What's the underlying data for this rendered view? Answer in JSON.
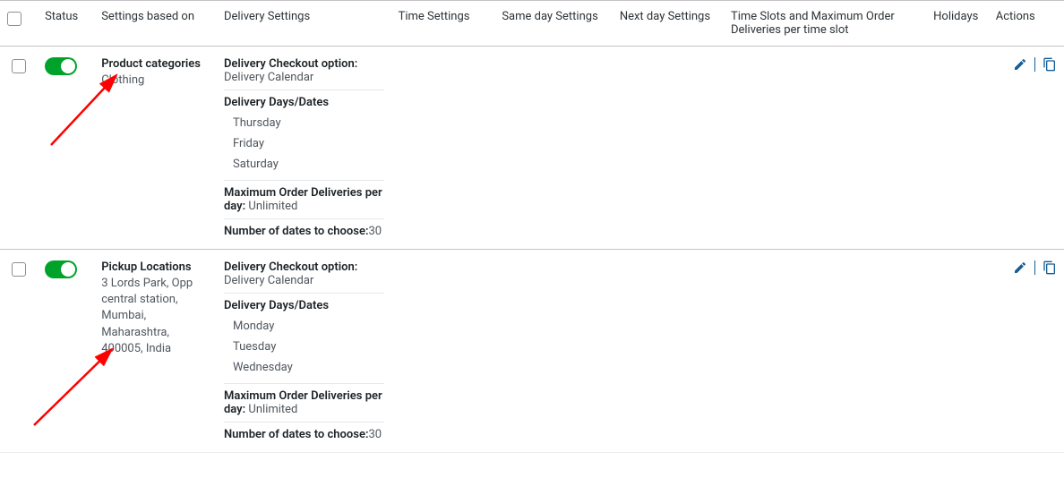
{
  "headers": {
    "status": "Status",
    "basis": "Settings based on",
    "delivery": "Delivery Settings",
    "time": "Time Settings",
    "sameday": "Same day Settings",
    "nextday": "Next day Settings",
    "slots": "Time Slots and Maximum Order Deliveries per time slot",
    "holidays": "Holidays",
    "actions": "Actions"
  },
  "labels": {
    "delivery_checkout_option": "Delivery Checkout option:",
    "delivery_days_dates": "Delivery Days/Dates",
    "max_per_day": "Maximum Order Deliveries per day:",
    "num_dates_to_choose": "Number of dates to choose:"
  },
  "rows": [
    {
      "status_on": true,
      "basis_title": "Product categories",
      "basis_sub": "Clothing",
      "checkout_value": "Delivery Calendar",
      "days": [
        "Thursday",
        "Friday",
        "Saturday"
      ],
      "max_per_day_value": "Unlimited",
      "num_dates_value": "30"
    },
    {
      "status_on": true,
      "basis_title": "Pickup Locations",
      "basis_sub": "3 Lords Park, Opp central station, Mumbai, Maharashtra, 400005, India",
      "checkout_value": "Delivery Calendar",
      "days": [
        "Monday",
        "Tuesday",
        "Wednesday"
      ],
      "max_per_day_value": "Unlimited",
      "num_dates_value": "30"
    }
  ]
}
